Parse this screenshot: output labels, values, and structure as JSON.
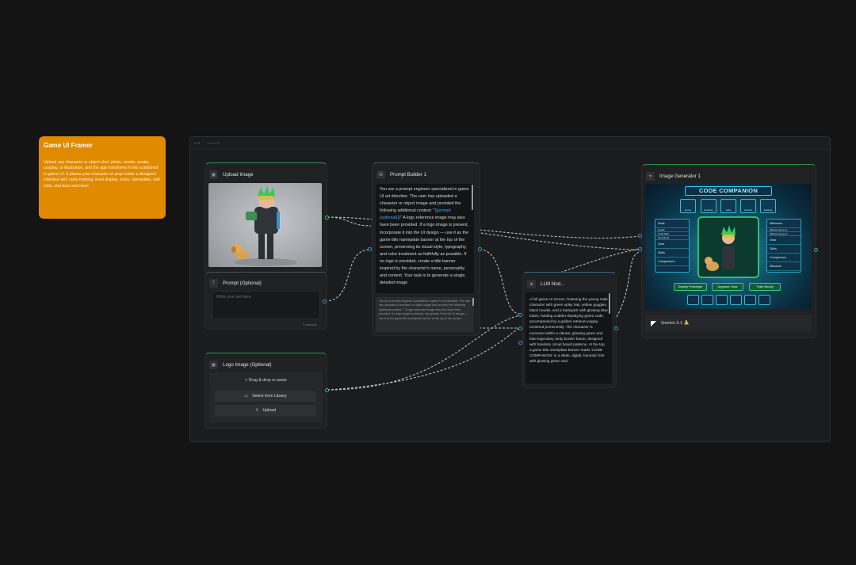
{
  "note": {
    "title": "Game UI Framer",
    "body": "Upload any character or object shot, photo, render, avatar, cosplay, or illustration, and the app transforms it into a polished in-game UI. It places your character or prop inside a designed interface with rarity framing, level display, icons, nameplate, skill slots, stat bars and more."
  },
  "group": {
    "label": "Game UI"
  },
  "nodes": {
    "upload_image": {
      "title": "Upload Image",
      "icon": "image-icon"
    },
    "prompt_optional": {
      "title": "Prompt (Optional)",
      "placeholder": "Write your text here",
      "counter": "0 character"
    },
    "logo_image": {
      "title": "Logo Image (Optional)",
      "drag_label": "Drag & drop or paste",
      "library_label": "Select from Library",
      "upload_label": "Upload"
    },
    "prompt_builder": {
      "title": "Prompt Builder 1",
      "text_a": "You are a prompt engineer specialized in game UI art direction.  The user has uploaded a character or object image and provided the following additional context: \"",
      "variable": "{{prompt (optional)}}",
      "text_b": "\"  A logo reference image may also have been provided. If a logo image is present, incorporate it into the UI design — use it as the game title nameplate banner at the top of the screen, preserving its visual style, typography, and color treatment as faithfully as possible. If no logo is provided, create a title banner inspired by the character's name, personality, and context.  Your task is to generate a single, detailed image",
      "preview": "You are a prompt engineer specialized in game UI art direction.  The user has uploaded a character or object image and provided the following additional context: \"\"  A logo reference image may also have been provided. If a logo image is present, incorporate it into the UI design — use it as the game title nameplate banner at the top of the screen,"
    },
    "llm": {
      "title": "LLM Nod...",
      "text": "A full game UI screen, featuring the young male character with green spiky hair, yellow goggles, black hoodie, and a backpack with glowing blue tubes, holding a tablet displaying green code, accompanied by a golden retriever puppy, centered prominently. The character is enclosed within a vibrant, glowing green and blue legendary rarity border frame, designed with futuristic circuit board patterns. At the top, a game title nameplate banner reads 'CODE COMPANION' in a sleek, digital, futuristic font with glowing green and"
    },
    "image_generator": {
      "title": "Image Generator 1",
      "model": "Gemini 3.1 🍌",
      "preview": {
        "banner": "CODE COMPANION",
        "tabs": [
          "Home",
          "Inventory",
          "Labs",
          "Comms",
          "Settings"
        ],
        "left_panel": [
          "Stats",
          "Health",
          "Code Skill",
          "Tech Bond",
          "Gear",
          "Skills",
          "Companions",
          "Missions"
        ],
        "right_panel": [
          "Milestone",
          "Mission Queue 1",
          "Mission Queue 2",
          "Gear",
          "Skills",
          "Companions",
          "Missions"
        ],
        "buttons": [
          "Deploy Prototype",
          "Upgrade Gear",
          "Train Buddy"
        ]
      }
    }
  },
  "colors": {
    "note": "#e08a00",
    "port_green": "#38c172",
    "port_blue": "#3a9bd9",
    "node_bg": "#202123",
    "canvas": "#141414"
  }
}
